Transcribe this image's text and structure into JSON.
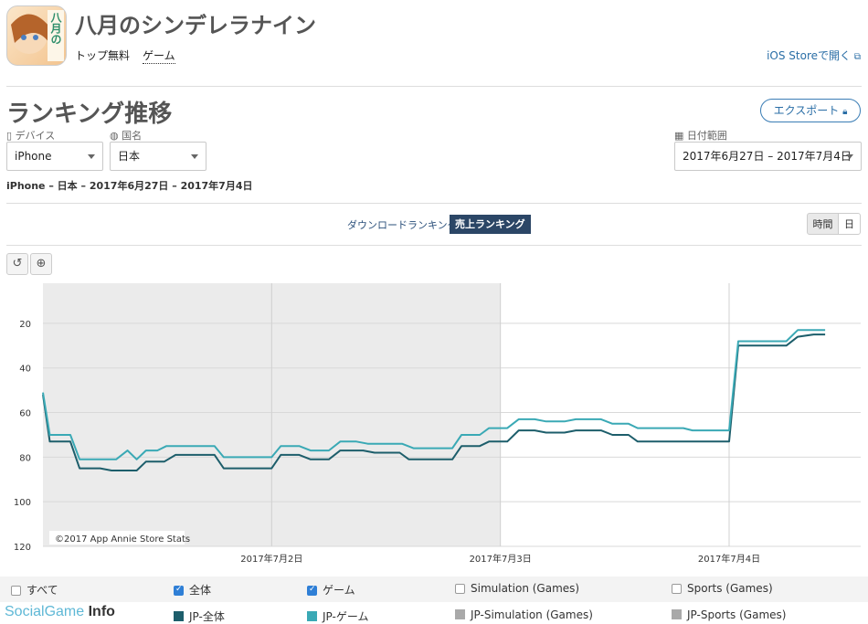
{
  "app": {
    "title": "八月のシンデレラナイン",
    "breadcrumbs": [
      "トップ無料",
      "ゲーム"
    ],
    "store_link": "iOS Storeで開く",
    "icon_text": "八月の"
  },
  "section": {
    "title": "ランキング推移",
    "export_label": "エクスポート",
    "device_label": "デバイス",
    "device_value": "iPhone",
    "country_label": "国名",
    "country_value": "日本",
    "date_label": "日付範囲",
    "date_value": "2017年6月27日 – 2017年7月4日",
    "summary": "iPhone – 日本 – 2017年6月27日 – 2017年7月4日"
  },
  "tabs": {
    "download": "ダウンロードランキング",
    "sales": "売上ランキング",
    "hour": "時間",
    "day": "日"
  },
  "colors": {
    "overall": "#1d5e6b",
    "game": "#3aa9b5",
    "simulation": "#a9a9a9",
    "sports": "#a9a9a9",
    "accent": "#2a6ea6"
  },
  "chart_data": {
    "type": "line",
    "copyright": "©2017 App Annie Store Stats",
    "ylim": [
      120,
      0
    ],
    "yticks": [
      20,
      40,
      60,
      80,
      100,
      120
    ],
    "x_ticks": [
      {
        "label": "2017年7月2日",
        "x": 5
      },
      {
        "label": "2017年7月3日",
        "x": 6
      },
      {
        "label": "2017年7月4日",
        "x": 7
      }
    ],
    "xlim": [
      4,
      7.42
    ],
    "series": [
      {
        "name": "JP-全体",
        "points": [
          [
            4.0,
            52
          ],
          [
            4.03,
            73
          ],
          [
            4.12,
            73
          ],
          [
            4.16,
            85
          ],
          [
            4.25,
            85
          ],
          [
            4.3,
            86
          ],
          [
            4.41,
            86
          ],
          [
            4.45,
            82
          ],
          [
            4.53,
            82
          ],
          [
            4.58,
            79
          ],
          [
            4.75,
            79
          ],
          [
            4.79,
            85
          ],
          [
            5.0,
            85
          ],
          [
            5.04,
            79
          ],
          [
            5.12,
            79
          ],
          [
            5.17,
            81
          ],
          [
            5.25,
            81
          ],
          [
            5.3,
            77
          ],
          [
            5.4,
            77
          ],
          [
            5.45,
            78
          ],
          [
            5.56,
            78
          ],
          [
            5.6,
            81
          ],
          [
            5.79,
            81
          ],
          [
            5.83,
            75
          ],
          [
            5.91,
            75
          ],
          [
            5.95,
            73
          ],
          [
            6.03,
            73
          ],
          [
            6.08,
            68
          ],
          [
            6.15,
            68
          ],
          [
            6.2,
            69
          ],
          [
            6.28,
            69
          ],
          [
            6.33,
            68
          ],
          [
            6.44,
            68
          ],
          [
            6.49,
            70
          ],
          [
            6.56,
            70
          ],
          [
            6.6,
            73
          ],
          [
            7.0,
            73
          ],
          [
            7.04,
            30
          ],
          [
            7.25,
            30
          ],
          [
            7.3,
            26
          ],
          [
            7.37,
            25
          ],
          [
            7.42,
            25
          ]
        ]
      },
      {
        "name": "JP-ゲーム",
        "points": [
          [
            4.0,
            51
          ],
          [
            4.03,
            70
          ],
          [
            4.12,
            70
          ],
          [
            4.16,
            81
          ],
          [
            4.32,
            81
          ],
          [
            4.37,
            77
          ],
          [
            4.41,
            81
          ],
          [
            4.45,
            77
          ],
          [
            4.5,
            77
          ],
          [
            4.54,
            75
          ],
          [
            4.75,
            75
          ],
          [
            4.79,
            80
          ],
          [
            5.0,
            80
          ],
          [
            5.04,
            75
          ],
          [
            5.12,
            75
          ],
          [
            5.17,
            77
          ],
          [
            5.25,
            77
          ],
          [
            5.3,
            73
          ],
          [
            5.37,
            73
          ],
          [
            5.42,
            74
          ],
          [
            5.57,
            74
          ],
          [
            5.62,
            76
          ],
          [
            5.79,
            76
          ],
          [
            5.83,
            70
          ],
          [
            5.91,
            70
          ],
          [
            5.95,
            67
          ],
          [
            6.03,
            67
          ],
          [
            6.08,
            63
          ],
          [
            6.15,
            63
          ],
          [
            6.2,
            64
          ],
          [
            6.28,
            64
          ],
          [
            6.33,
            63
          ],
          [
            6.44,
            63
          ],
          [
            6.49,
            65
          ],
          [
            6.56,
            65
          ],
          [
            6.6,
            67
          ],
          [
            6.8,
            67
          ],
          [
            6.84,
            68
          ],
          [
            7.0,
            68
          ],
          [
            7.04,
            28
          ],
          [
            7.25,
            28
          ],
          [
            7.3,
            23
          ],
          [
            7.37,
            23
          ],
          [
            7.42,
            23
          ]
        ]
      }
    ]
  },
  "legend": [
    {
      "label": "すべて",
      "checked": false
    },
    {
      "label": "全体",
      "checked": true
    },
    {
      "label": "ゲーム",
      "checked": true
    },
    {
      "label": "Simulation (Games)",
      "checked": false
    },
    {
      "label": "Sports (Games)",
      "checked": false
    }
  ],
  "series_legend": [
    "JP-全体",
    "JP-ゲーム",
    "JP-Simulation (Games)",
    "JP-Sports (Games)"
  ],
  "watermark": {
    "part1": "SocialGame",
    "part2": "Info"
  }
}
